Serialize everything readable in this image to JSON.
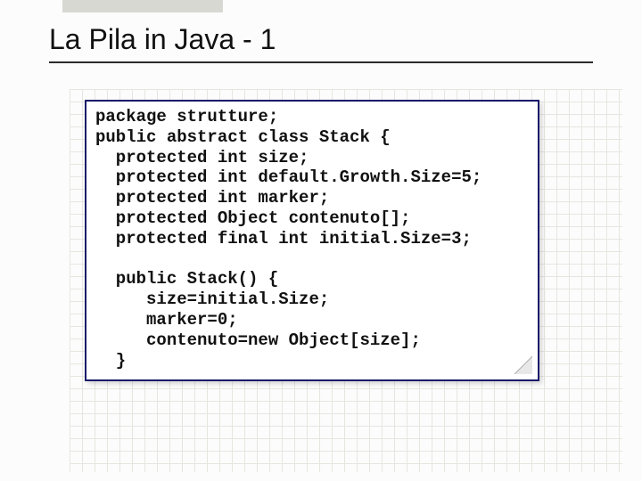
{
  "title": "La Pila in Java - 1",
  "code": {
    "lines": [
      "package strutture;",
      "public abstract class Stack {",
      "  protected int size;",
      "  protected int default.Growth.Size=5;",
      "  protected int marker;",
      "  protected Object contenuto[];",
      "  protected final int initial.Size=3;",
      "",
      "  public Stack() {",
      "     size=initial.Size;",
      "     marker=0;",
      "     contenuto=new Object[size];",
      "  }"
    ]
  }
}
